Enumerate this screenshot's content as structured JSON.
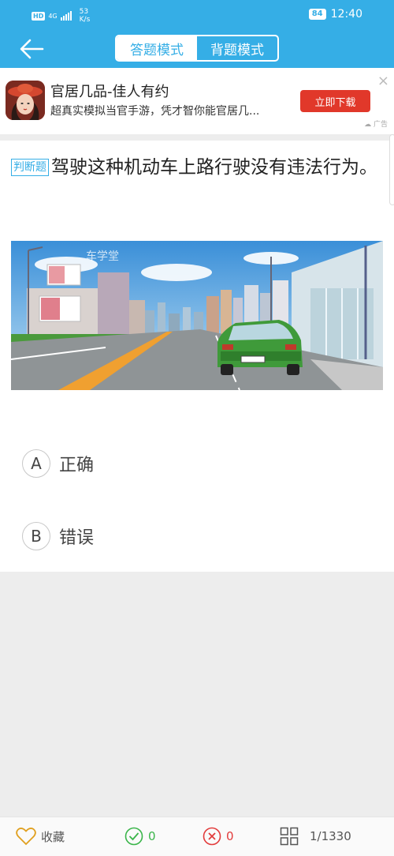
{
  "status_bar": {
    "hd": "HD",
    "network": "4G",
    "speed_value": "53",
    "speed_unit": "K/s",
    "battery": "84",
    "time": "12:40"
  },
  "header": {
    "back_icon": "arrow-left-icon",
    "tabs": [
      {
        "label": "答题模式",
        "active": true
      },
      {
        "label": "背题模式",
        "active": false
      }
    ]
  },
  "ad": {
    "title": "官居几品-佳人有约",
    "description": "超真实模拟当官手游，凭才智你能官居几...",
    "button_label": "立即下载",
    "close_icon": "close-icon",
    "mark": "广告"
  },
  "question": {
    "type_tag": "判断题",
    "text": "驾驶这种机动车上路行驶没有违法行为。",
    "image_watermark": "车学堂",
    "options": [
      {
        "letter": "A",
        "text": "正确"
      },
      {
        "letter": "B",
        "text": "错误"
      }
    ]
  },
  "bottom_bar": {
    "favorite_label": "收藏",
    "correct_count": "0",
    "wrong_count": "0",
    "progress": "1/1330"
  },
  "colors": {
    "accent": "#35aee6",
    "download_button": "#e1382a",
    "correct": "#3ab54a",
    "wrong": "#e23b3b"
  }
}
